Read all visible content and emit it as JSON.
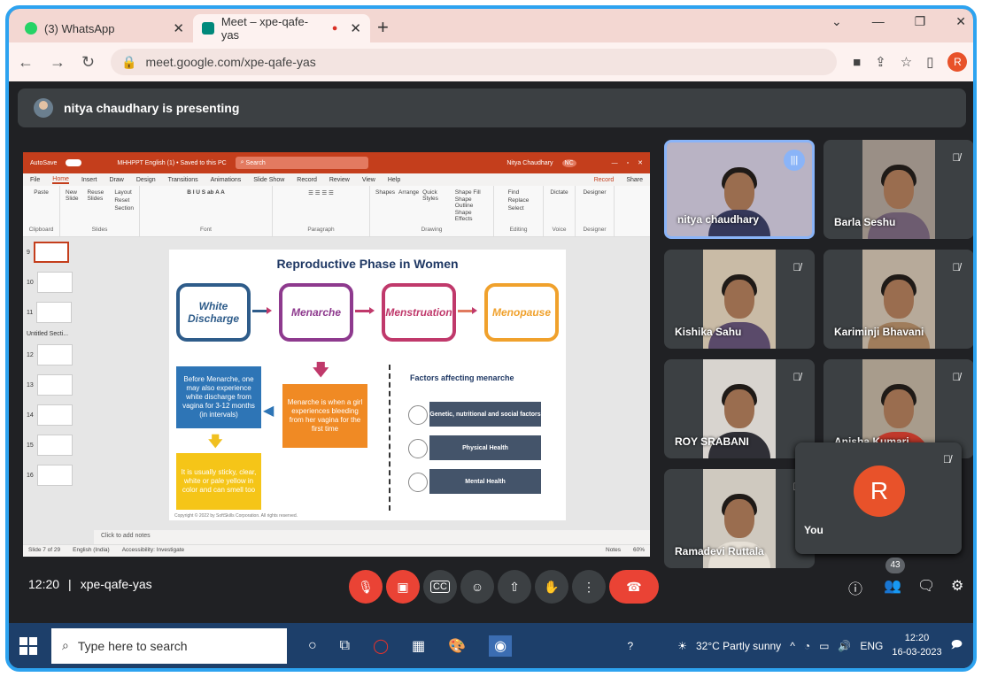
{
  "browser": {
    "tabs": [
      {
        "label": "(3) WhatsApp",
        "color": "#25d366"
      },
      {
        "label": "Meet – xpe-qafe-yas",
        "color": "#00897b"
      }
    ],
    "url": "meet.google.com/xpe-qafe-yas",
    "profile_initial": "R"
  },
  "meet": {
    "presenting": "nitya chaudhary is presenting",
    "time": "12:20",
    "code": "xpe-qafe-yas",
    "participant_count": "43",
    "you_initial": "R",
    "you_label": "You",
    "participants": [
      "nitya chaudhary",
      "Barla Seshu",
      "Kishika Sahu",
      "Kariminji Bhavani",
      "ROY SRABANI",
      "Anisha Kumari",
      "Ramadevi Ruttala"
    ]
  },
  "ppt": {
    "autosave": "AutoSave",
    "doc_title": "MHHPPT English (1) • Saved to this PC",
    "search": "Search",
    "user": "Nitya Chaudhary",
    "user_initials": "NC",
    "menu": [
      "File",
      "Home",
      "Insert",
      "Draw",
      "Design",
      "Transitions",
      "Animations",
      "Slide Show",
      "Record",
      "Review",
      "View",
      "Help"
    ],
    "record": "Record",
    "share": "Share",
    "groups": [
      "Clipboard",
      "Slides",
      "Font",
      "Paragraph",
      "Drawing",
      "Editing",
      "Voice",
      "Designer"
    ],
    "buttons": {
      "paste": "Paste",
      "new_slide": "New Slide",
      "reuse": "Reuse Slides",
      "layout": "Layout",
      "reset": "Reset",
      "section": "Section",
      "shapes": "Shapes",
      "arrange": "Arrange",
      "quick": "Quick Styles",
      "fill": "Shape Fill",
      "outline": "Shape Outline",
      "effects": "Shape Effects",
      "find": "Find",
      "replace": "Replace",
      "select": "Select",
      "dictate": "Dictate",
      "designer": "Designer"
    },
    "thumbs": [
      "9",
      "10",
      "11",
      "12",
      "13",
      "14",
      "15",
      "16"
    ],
    "section": "Untitled Secti...",
    "notes": "Click to add notes",
    "status": {
      "slide": "Slide 7 of 29",
      "lang": "English (India)",
      "access": "Accessibility: Investigate",
      "notes": "Notes",
      "zoom": "60%"
    }
  },
  "slide": {
    "title": "Reproductive Phase in Women",
    "stages": [
      {
        "label": "White Discharge",
        "color": "#2e5c8a"
      },
      {
        "label": "Menarche",
        "color": "#8e3a8e"
      },
      {
        "label": "Menstruation",
        "color": "#c0396b"
      },
      {
        "label": "Menopause",
        "color": "#f0a12c"
      }
    ],
    "before": "Before Menarche, one may also experience white discharge from vagina for 3-12 months (in intervals)",
    "sticky": "It is usually sticky, clear, white or pale yellow in color and can smell too",
    "menarche_def": "Menarche is when a girl experiences bleeding from her vagina for the first time",
    "factors_title": "Factors affecting menarche",
    "factors": [
      "Genetic, nutritional and social factors",
      "Physical Health",
      "Mental Health"
    ],
    "copyright": "Copyright © 2022 by SoftSkills Corporation. All rights reserved."
  },
  "taskbar": {
    "search": "Type here to search",
    "weather": "32°C  Partly sunny",
    "lang": "ENG",
    "time": "12:20",
    "date": "16-03-2023"
  }
}
